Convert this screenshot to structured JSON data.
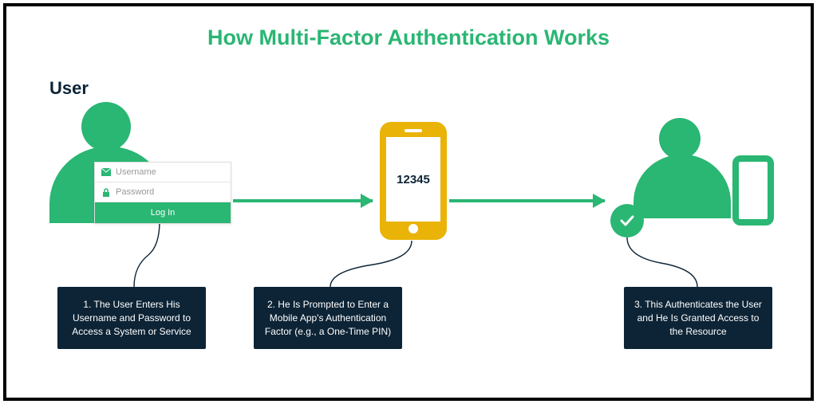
{
  "title": "How Multi-Factor Authentication Works",
  "user_label": "User",
  "login": {
    "username_placeholder": "Username",
    "password_placeholder": "Password",
    "button_label": "Log In"
  },
  "phone": {
    "code": "12345"
  },
  "steps": {
    "s1": "1. The User Enters His Username and Password to Access a System or Service",
    "s2": "2. He Is Prompted to Enter a Mobile App's Authentication Factor (e.g., a One-Time PIN)",
    "s3": "3. This Authenticates the User and He Is Granted Access to the Resource"
  },
  "colors": {
    "primary": "#2ab673",
    "phone": "#eab308",
    "box": "#0d2436"
  }
}
